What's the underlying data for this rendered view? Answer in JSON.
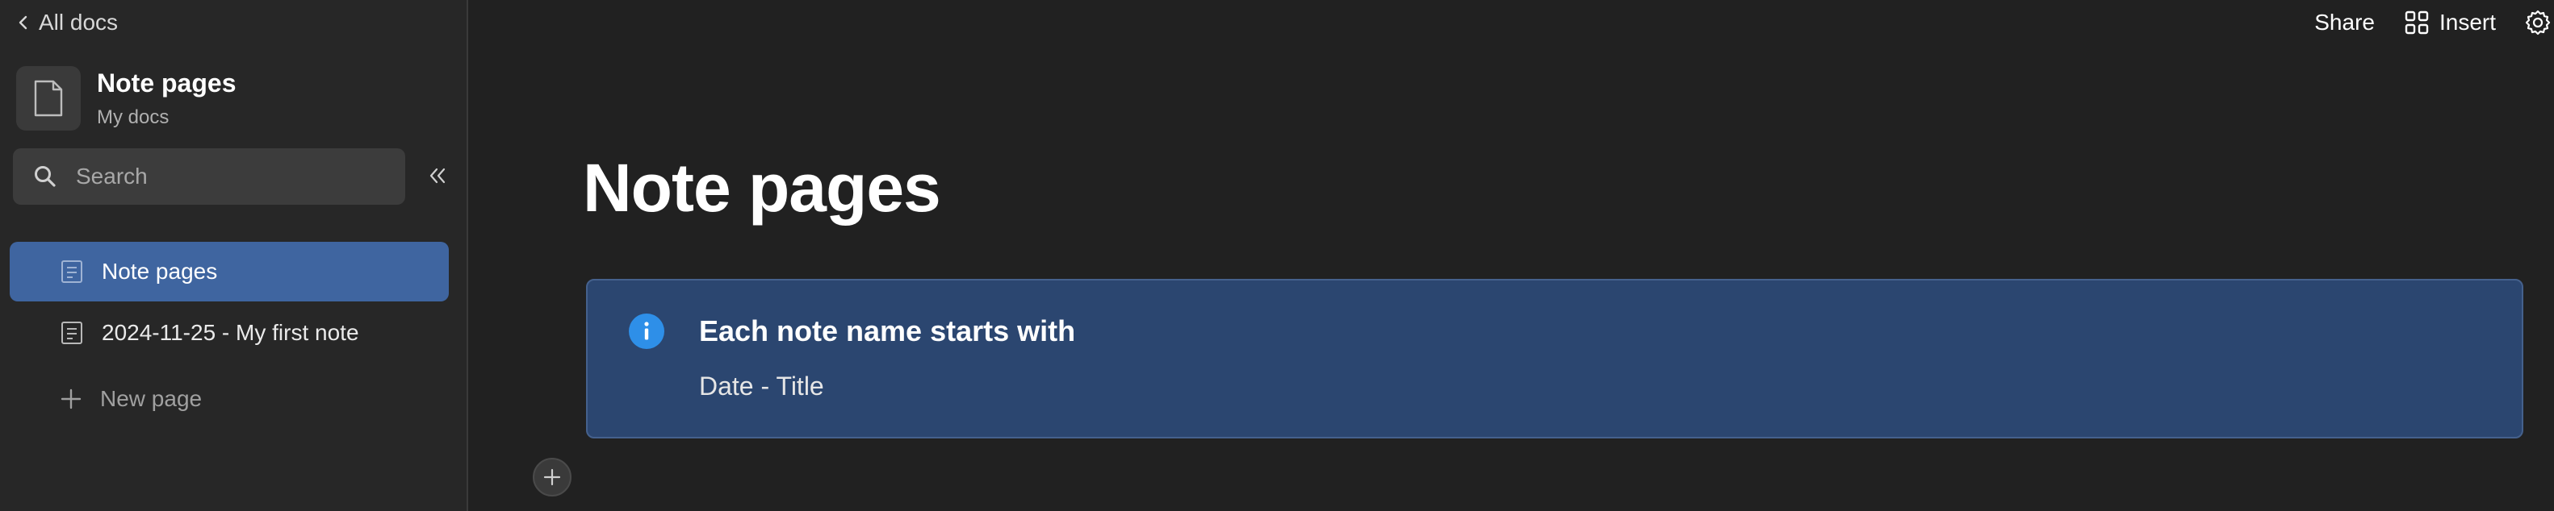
{
  "sidebar": {
    "back_label": "All docs",
    "doc_title": "Note pages",
    "doc_subtitle": "My docs",
    "search_placeholder": "Search",
    "pages": [
      {
        "label": "Note pages",
        "active": true
      },
      {
        "label": "2024-11-25 - My first note",
        "active": false
      }
    ],
    "new_page_label": "New page"
  },
  "topbar": {
    "share_label": "Share",
    "insert_label": "Insert"
  },
  "main": {
    "title": "Note pages",
    "callout": {
      "heading": "Each note name starts with",
      "body": "Date - Title"
    }
  },
  "colors": {
    "background": "#212121",
    "sidebar": "#272727",
    "active_item": "#3f65a0",
    "callout_bg": "#2b4670",
    "info_icon": "#2e8fe8"
  },
  "icons": {
    "back": "chevron-left-icon",
    "doc": "file-icon",
    "search": "search-icon",
    "collapse": "double-chevron-left-icon",
    "page": "page-icon",
    "new_page": "plus-icon",
    "insert": "grid-icon",
    "settings": "gear-icon",
    "callout": "info-icon",
    "add_block": "plus-icon"
  }
}
